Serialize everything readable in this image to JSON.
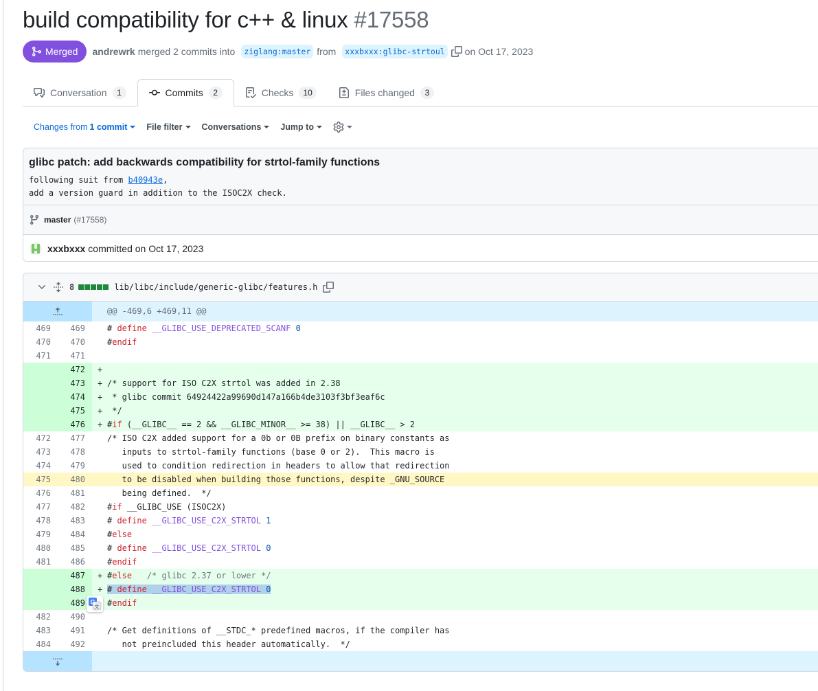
{
  "pr": {
    "title": "build compatibility for c++ & linux",
    "number": "#17558",
    "status": "Merged",
    "author": "andrewrk",
    "merge_text": "merged 2 commits into",
    "base_branch": "ziglang:master",
    "from_text": "from",
    "head_branch": "xxxbxxx:glibc-strtoul",
    "date_text": "on Oct 17, 2023"
  },
  "tabs": [
    {
      "label": "Conversation",
      "count": "1",
      "icon": "comment-discussion-icon"
    },
    {
      "label": "Commits",
      "count": "2",
      "icon": "git-commit-icon",
      "active": true
    },
    {
      "label": "Checks",
      "count": "10",
      "icon": "checklist-icon"
    },
    {
      "label": "Files changed",
      "count": "3",
      "icon": "file-diff-icon"
    }
  ],
  "toolbar": {
    "changes_from": "Changes from",
    "changes_value": "1 commit",
    "file_filter": "File filter",
    "conversations": "Conversations",
    "jump_to": "Jump to"
  },
  "commit": {
    "title": "glibc patch: add backwards compatibility for strtol-family functions",
    "body_prefix": "following suit from ",
    "body_link": "b40943e",
    "body_suffix": ",",
    "body_line2": "add a version guard in addition to the ISOC2X check.",
    "branch": "master",
    "pr_ref": "(#17558)",
    "author": "xxxbxxx",
    "committed_text": "committed on Oct 17, 2023"
  },
  "diff": {
    "changes_count": "8",
    "file_path": "lib/libc/include/generic-glibc/features.h",
    "hunk_header": "@@ -469,6 +469,11 @@",
    "lines": [
      {
        "type": "ctx",
        "old": "469",
        "new": "469",
        "mark": " "
      },
      {
        "type": "ctx",
        "old": "470",
        "new": "470",
        "mark": " "
      },
      {
        "type": "ctx",
        "old": "471",
        "new": "471",
        "mark": " "
      },
      {
        "type": "add",
        "old": "",
        "new": "472",
        "mark": "+"
      },
      {
        "type": "add",
        "old": "",
        "new": "473",
        "mark": "+"
      },
      {
        "type": "add",
        "old": "",
        "new": "474",
        "mark": "+"
      },
      {
        "type": "add",
        "old": "",
        "new": "475",
        "mark": "+"
      },
      {
        "type": "add",
        "old": "",
        "new": "476",
        "mark": "+"
      },
      {
        "type": "ctx",
        "old": "472",
        "new": "477",
        "mark": " "
      },
      {
        "type": "ctx",
        "old": "473",
        "new": "478",
        "mark": " "
      },
      {
        "type": "ctx",
        "old": "474",
        "new": "479",
        "mark": " "
      },
      {
        "type": "hl",
        "old": "475",
        "new": "480",
        "mark": " "
      },
      {
        "type": "ctx",
        "old": "476",
        "new": "481",
        "mark": " "
      },
      {
        "type": "ctx",
        "old": "477",
        "new": "482",
        "mark": " "
      },
      {
        "type": "ctx",
        "old": "478",
        "new": "483",
        "mark": " "
      },
      {
        "type": "ctx",
        "old": "479",
        "new": "484",
        "mark": " "
      },
      {
        "type": "ctx",
        "old": "480",
        "new": "485",
        "mark": " "
      },
      {
        "type": "ctx",
        "old": "481",
        "new": "486",
        "mark": " "
      },
      {
        "type": "add",
        "old": "",
        "new": "487",
        "mark": "+"
      },
      {
        "type": "add",
        "old": "",
        "new": "488",
        "mark": "+"
      },
      {
        "type": "add",
        "old": "",
        "new": "489",
        "mark": "+"
      },
      {
        "type": "ctx",
        "old": "482",
        "new": "490",
        "mark": " "
      },
      {
        "type": "ctx",
        "old": "483",
        "new": "491",
        "mark": " "
      },
      {
        "type": "ctx",
        "old": "484",
        "new": "492",
        "mark": " "
      }
    ],
    "code": {
      "l0a": "# ",
      "l0b": "define",
      "l0c": " ",
      "l0d": "__GLIBC_USE_DEPRECATED_SCANF",
      "l0e": " ",
      "l0f": "0",
      "l1a": "#",
      "l1b": "endif",
      "l3": "",
      "l4": "/* support for ISO C2X strtol was added in 2.38",
      "l5": " * glibc commit 64924422a99690d147a166b4de3103f3bf3eaf6c",
      "l6": " */",
      "l7a": "#",
      "l7b": "if",
      "l7c": " (__GLIBC__ == 2 && __GLIBC_MINOR__ >= 38) || __GLIBC__ > 2",
      "l8": "/* ISO C2X added support for a 0b or 0B prefix on binary constants as",
      "l9": "   inputs to strtol-family functions (base 0 or 2).  This macro is",
      "l10": "   used to condition redirection in headers to allow that redirection",
      "l11": "   to be disabled when building those functions, despite _GNU_SOURCE",
      "l12": "   being defined.  */",
      "l13a": "#",
      "l13b": "if",
      "l13c": " __GLIBC_USE (ISOC2X)",
      "l14a": "# ",
      "l14b": "define",
      "l14c": " ",
      "l14d": "__GLIBC_USE_C2X_STRTOL",
      "l14e": " ",
      "l14f": "1",
      "l15a": "#",
      "l15b": "else",
      "l16a": "# ",
      "l16b": "define",
      "l16c": " ",
      "l16d": "__GLIBC_USE_C2X_STRTOL",
      "l16e": " ",
      "l16f": "0",
      "l17a": "#",
      "l17b": "endif",
      "l18a": "#",
      "l18b": "else",
      "l18c": "   ",
      "l18d": "/* glibc 2.37 or lower */",
      "l19a": "# ",
      "l19b": "define",
      "l19c": " ",
      "l19d": "__GLIBC_USE_C2X_STRTOL",
      "l19e": " ",
      "l19f": "0",
      "l20a": "#",
      "l20b": "endif",
      "l21": "",
      "l22": "/* Get definitions of __STDC_* predefined macros, if the compiler has",
      "l23": "   not preincluded this header automatically.  */"
    }
  },
  "colors": {
    "merged": "#8250df",
    "link": "#0969da",
    "add_bg": "#e6ffec",
    "add_gutter": "#ccffd8",
    "hunk_bg": "#ddf4ff",
    "highlight_bg": "#fff8c5",
    "keyword": "#cf222e",
    "macro": "#8250df",
    "number": "#0550ae"
  }
}
